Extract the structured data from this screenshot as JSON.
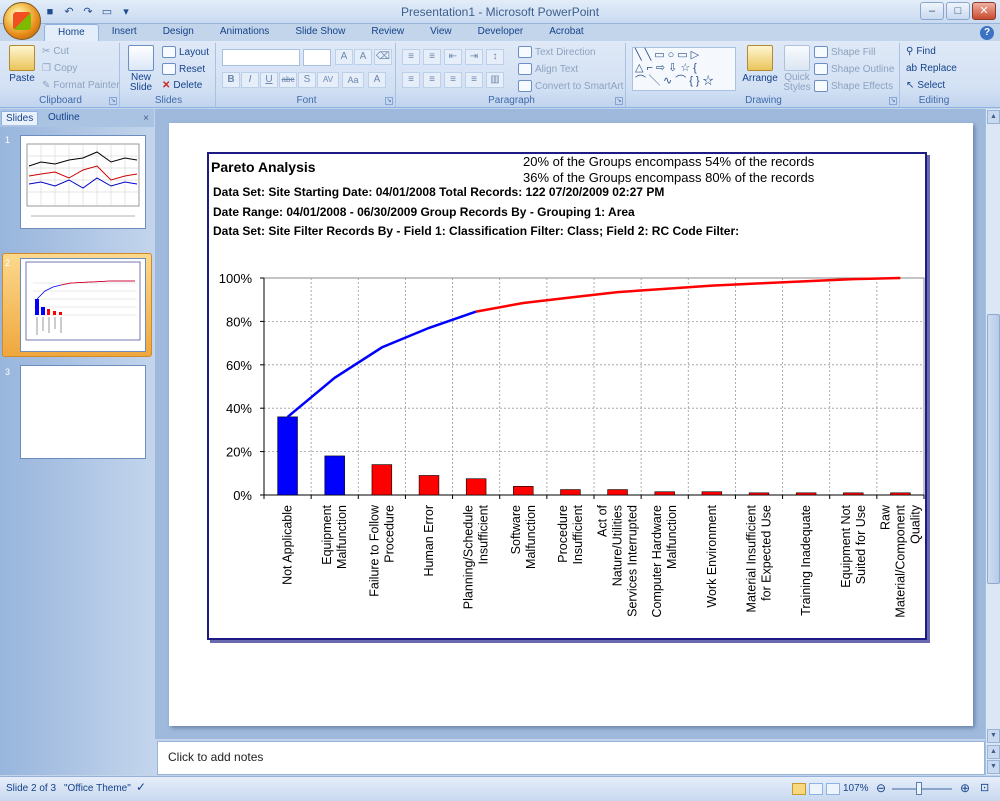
{
  "window": {
    "title": "Presentation1 - Microsoft PowerPoint"
  },
  "tabs": [
    "Home",
    "Insert",
    "Design",
    "Animations",
    "Slide Show",
    "Review",
    "View",
    "Developer",
    "Acrobat"
  ],
  "ribbon": {
    "clipboard": {
      "label": "Clipboard",
      "paste": "Paste",
      "cut": "Cut",
      "copy": "Copy",
      "format_painter": "Format Painter"
    },
    "slides": {
      "label": "Slides",
      "new_slide_1": "New",
      "new_slide_2": "Slide",
      "layout": "Layout",
      "reset": "Reset",
      "delete": "Delete"
    },
    "font": {
      "label": "Font",
      "bold": "B",
      "italic": "I",
      "underline": "U",
      "strike": "abc",
      "shadow": "S",
      "spacing": "AV",
      "case": "Aa"
    },
    "paragraph": {
      "label": "Paragraph",
      "text_direction": "Text Direction",
      "align_text": "Align Text",
      "smartart": "Convert to SmartArt"
    },
    "drawing": {
      "label": "Drawing",
      "arrange": "Arrange",
      "quick_styles_1": "Quick",
      "quick_styles_2": "Styles",
      "shape_fill": "Shape Fill",
      "shape_outline": "Shape Outline",
      "shape_effects": "Shape Effects"
    },
    "editing": {
      "label": "Editing",
      "find": "Find",
      "replace": "Replace",
      "select": "Select"
    }
  },
  "left_pane": {
    "tabs": [
      "Slides",
      "Outline"
    ],
    "close": "×",
    "slide_numbers": [
      "1",
      "2",
      "3"
    ]
  },
  "slide": {
    "title": "Pareto Analysis",
    "summary_1": "20% of the Groups encompass 54% of the records",
    "summary_2": "36% of the Groups encompass 80% of the records",
    "line_1": "Data Set: Site     Starting Date: 04/01/2008     Total Records: 122       07/20/2009 02:27 PM",
    "line_2": "Date Range: 04/01/2008 - 06/30/2009   Group Records By - Grouping 1: Area",
    "line_3": "Data Set: Site   Filter Records By - Field 1: Classification  Filter: Class; Field 2: RC Code  Filter:"
  },
  "chart_data": {
    "type": "bar",
    "categories": [
      [
        "Not Applicable"
      ],
      [
        "Equipment",
        "Malfunction"
      ],
      [
        "Failure to Follow",
        "Procedure"
      ],
      [
        "Human Error"
      ],
      [
        "Planning/Schedule",
        "Insufficient"
      ],
      [
        "Software",
        "Malfunction"
      ],
      [
        "Procedure",
        "Insufficient"
      ],
      [
        "Act of",
        "Nature/Utilities",
        "Services Interrupted"
      ],
      [
        "Computer Hardware",
        "Malfunction"
      ],
      [
        "Work Environment"
      ],
      [
        "Material Insufficient",
        "for Expected Use"
      ],
      [
        "Training Inadequate"
      ],
      [
        "Equipment Not",
        "Suited for Use"
      ],
      [
        "Raw",
        "Material/Component",
        "Quality"
      ]
    ],
    "values": [
      36,
      18,
      14,
      9,
      7.5,
      4,
      2.5,
      2.5,
      1.5,
      1.5,
      1,
      1,
      1,
      1
    ],
    "cumulative": [
      36,
      54,
      68,
      77,
      84.5,
      88.5,
      91,
      93.5,
      95,
      96.5,
      97.5,
      98.5,
      99.5,
      100
    ],
    "highlight_count": 2,
    "y_ticks": [
      "0%",
      "20%",
      "40%",
      "60%",
      "80%",
      "100%"
    ],
    "ylim": [
      0,
      100
    ],
    "grid": true,
    "colors": {
      "highlight": "#0000ff",
      "normal": "#ff0000",
      "line_blue": "#0000ff",
      "line_red": "#ff0000"
    }
  },
  "notes": {
    "placeholder": "Click to add notes"
  },
  "status": {
    "slide": "Slide 2 of 3",
    "theme": "\"Office Theme\"",
    "zoom": "107%"
  }
}
